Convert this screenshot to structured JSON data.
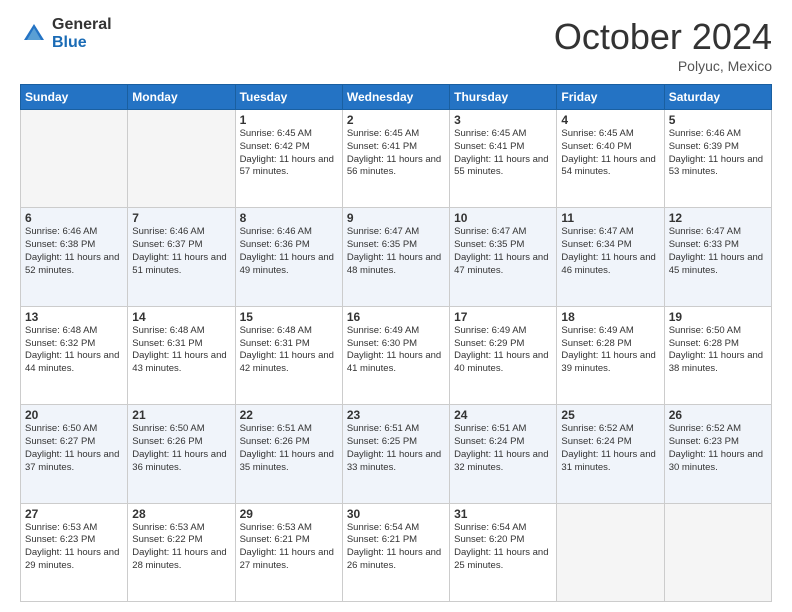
{
  "logo": {
    "general": "General",
    "blue": "Blue"
  },
  "title": "October 2024",
  "location": "Polyuc, Mexico",
  "days_of_week": [
    "Sunday",
    "Monday",
    "Tuesday",
    "Wednesday",
    "Thursday",
    "Friday",
    "Saturday"
  ],
  "weeks": [
    [
      {
        "day": "",
        "info": ""
      },
      {
        "day": "",
        "info": ""
      },
      {
        "day": "1",
        "info": "Sunrise: 6:45 AM\nSunset: 6:42 PM\nDaylight: 11 hours and 57 minutes."
      },
      {
        "day": "2",
        "info": "Sunrise: 6:45 AM\nSunset: 6:41 PM\nDaylight: 11 hours and 56 minutes."
      },
      {
        "day": "3",
        "info": "Sunrise: 6:45 AM\nSunset: 6:41 PM\nDaylight: 11 hours and 55 minutes."
      },
      {
        "day": "4",
        "info": "Sunrise: 6:45 AM\nSunset: 6:40 PM\nDaylight: 11 hours and 54 minutes."
      },
      {
        "day": "5",
        "info": "Sunrise: 6:46 AM\nSunset: 6:39 PM\nDaylight: 11 hours and 53 minutes."
      }
    ],
    [
      {
        "day": "6",
        "info": "Sunrise: 6:46 AM\nSunset: 6:38 PM\nDaylight: 11 hours and 52 minutes."
      },
      {
        "day": "7",
        "info": "Sunrise: 6:46 AM\nSunset: 6:37 PM\nDaylight: 11 hours and 51 minutes."
      },
      {
        "day": "8",
        "info": "Sunrise: 6:46 AM\nSunset: 6:36 PM\nDaylight: 11 hours and 49 minutes."
      },
      {
        "day": "9",
        "info": "Sunrise: 6:47 AM\nSunset: 6:35 PM\nDaylight: 11 hours and 48 minutes."
      },
      {
        "day": "10",
        "info": "Sunrise: 6:47 AM\nSunset: 6:35 PM\nDaylight: 11 hours and 47 minutes."
      },
      {
        "day": "11",
        "info": "Sunrise: 6:47 AM\nSunset: 6:34 PM\nDaylight: 11 hours and 46 minutes."
      },
      {
        "day": "12",
        "info": "Sunrise: 6:47 AM\nSunset: 6:33 PM\nDaylight: 11 hours and 45 minutes."
      }
    ],
    [
      {
        "day": "13",
        "info": "Sunrise: 6:48 AM\nSunset: 6:32 PM\nDaylight: 11 hours and 44 minutes."
      },
      {
        "day": "14",
        "info": "Sunrise: 6:48 AM\nSunset: 6:31 PM\nDaylight: 11 hours and 43 minutes."
      },
      {
        "day": "15",
        "info": "Sunrise: 6:48 AM\nSunset: 6:31 PM\nDaylight: 11 hours and 42 minutes."
      },
      {
        "day": "16",
        "info": "Sunrise: 6:49 AM\nSunset: 6:30 PM\nDaylight: 11 hours and 41 minutes."
      },
      {
        "day": "17",
        "info": "Sunrise: 6:49 AM\nSunset: 6:29 PM\nDaylight: 11 hours and 40 minutes."
      },
      {
        "day": "18",
        "info": "Sunrise: 6:49 AM\nSunset: 6:28 PM\nDaylight: 11 hours and 39 minutes."
      },
      {
        "day": "19",
        "info": "Sunrise: 6:50 AM\nSunset: 6:28 PM\nDaylight: 11 hours and 38 minutes."
      }
    ],
    [
      {
        "day": "20",
        "info": "Sunrise: 6:50 AM\nSunset: 6:27 PM\nDaylight: 11 hours and 37 minutes."
      },
      {
        "day": "21",
        "info": "Sunrise: 6:50 AM\nSunset: 6:26 PM\nDaylight: 11 hours and 36 minutes."
      },
      {
        "day": "22",
        "info": "Sunrise: 6:51 AM\nSunset: 6:26 PM\nDaylight: 11 hours and 35 minutes."
      },
      {
        "day": "23",
        "info": "Sunrise: 6:51 AM\nSunset: 6:25 PM\nDaylight: 11 hours and 33 minutes."
      },
      {
        "day": "24",
        "info": "Sunrise: 6:51 AM\nSunset: 6:24 PM\nDaylight: 11 hours and 32 minutes."
      },
      {
        "day": "25",
        "info": "Sunrise: 6:52 AM\nSunset: 6:24 PM\nDaylight: 11 hours and 31 minutes."
      },
      {
        "day": "26",
        "info": "Sunrise: 6:52 AM\nSunset: 6:23 PM\nDaylight: 11 hours and 30 minutes."
      }
    ],
    [
      {
        "day": "27",
        "info": "Sunrise: 6:53 AM\nSunset: 6:23 PM\nDaylight: 11 hours and 29 minutes."
      },
      {
        "day": "28",
        "info": "Sunrise: 6:53 AM\nSunset: 6:22 PM\nDaylight: 11 hours and 28 minutes."
      },
      {
        "day": "29",
        "info": "Sunrise: 6:53 AM\nSunset: 6:21 PM\nDaylight: 11 hours and 27 minutes."
      },
      {
        "day": "30",
        "info": "Sunrise: 6:54 AM\nSunset: 6:21 PM\nDaylight: 11 hours and 26 minutes."
      },
      {
        "day": "31",
        "info": "Sunrise: 6:54 AM\nSunset: 6:20 PM\nDaylight: 11 hours and 25 minutes."
      },
      {
        "day": "",
        "info": ""
      },
      {
        "day": "",
        "info": ""
      }
    ]
  ]
}
